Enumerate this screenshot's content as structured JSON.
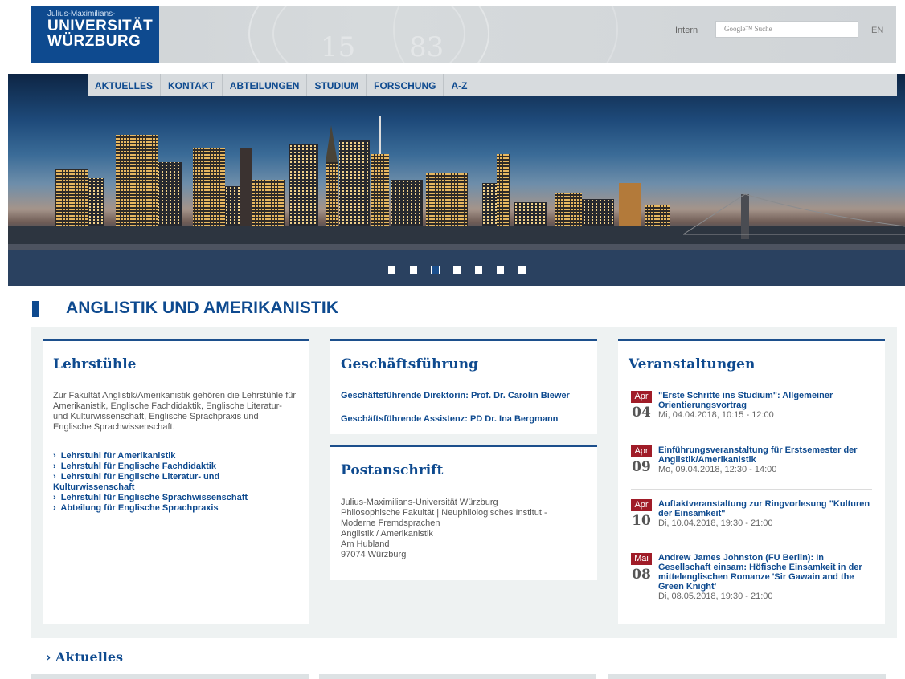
{
  "header": {
    "logo_small": "Julius-Maximilians-",
    "logo_line1": "UNIVERSITÄT",
    "logo_line2": "WÜRZBURG",
    "seal_numbers": [
      "15",
      "83"
    ],
    "intern_label": "Intern",
    "search_placeholder": "Google™ Suche",
    "lang_label": "EN"
  },
  "nav": {
    "items": [
      "AKTUELLES",
      "KONTAKT",
      "ABTEILUNGEN",
      "STUDIUM",
      "FORSCHUNG",
      "A-Z"
    ]
  },
  "slider": {
    "count": 7,
    "active_index": 2
  },
  "page_title": "ANGLISTIK UND AMERIKANISTIK",
  "lehrstuehle": {
    "title": "Lehrstühle",
    "intro": "Zur Fakultät Anglistik/Amerikanistik gehören die Lehrstühle für Amerikanistik, Englische Fachdidaktik, Englische Literatur- und Kulturwissenschaft, Englische Sprachpraxis und Englische Sprachwissenschaft.",
    "links": [
      "Lehrstuhl für Amerikanistik",
      "Lehrstuhl für Englische Fachdidaktik",
      "Lehrstuhl für Englische Literatur- und Kulturwissenschaft",
      "Lehrstuhl für Englische Sprachwissenschaft",
      "Abteilung für Englische Sprachpraxis"
    ]
  },
  "geschaeftsfuehrung": {
    "title": "Geschäftsführung",
    "line1": "Geschäftsführende Direktorin:  Prof. Dr. Carolin Biewer",
    "line2": "Geschäftsführende Assistenz: PD Dr. Ina Bergmann"
  },
  "postanschrift": {
    "title": "Postanschrift",
    "lines": [
      "Julius-Maximilians-Universität Würzburg",
      "Philosophische Fakultät | Neuphilologisches Institut - Moderne Fremdsprachen",
      "Anglistik / Amerikanistik",
      "Am Hubland",
      "97074 Würzburg"
    ]
  },
  "veranstaltungen": {
    "title": "Veranstaltungen",
    "events": [
      {
        "month": "Apr",
        "day": "04",
        "title": "\"Erste Schritte ins Studium\": Allgemeiner Orientierungsvortrag",
        "date": "Mi, 04.04.2018, 10:15 - 12:00"
      },
      {
        "month": "Apr",
        "day": "09",
        "title": "Einführungsveranstaltung für Erstsemester der Anglistik/Amerikanistik",
        "date": "Mo, 09.04.2018, 12:30 - 14:00"
      },
      {
        "month": "Apr",
        "day": "10",
        "title": "Auftaktveranstaltung zur Ringvorlesung \"Kulturen der Einsamkeit\"",
        "date": "Di, 10.04.2018, 19:30 - 21:00"
      },
      {
        "month": "Mai",
        "day": "08",
        "title": "Andrew James Johnston (FU Berlin): In Gesellschaft einsam: Höfische Einsamkeit in der mittelenglischen Romanze 'Sir Gawain and the Green Knight'",
        "date": "Di, 08.05.2018, 19:30 - 21:00"
      }
    ]
  },
  "aktuelles": {
    "heading": "Aktuelles"
  },
  "colors": {
    "brand": "#0e4a8f",
    "event_badge": "#a01c28",
    "content_bg": "#eef2f2"
  }
}
